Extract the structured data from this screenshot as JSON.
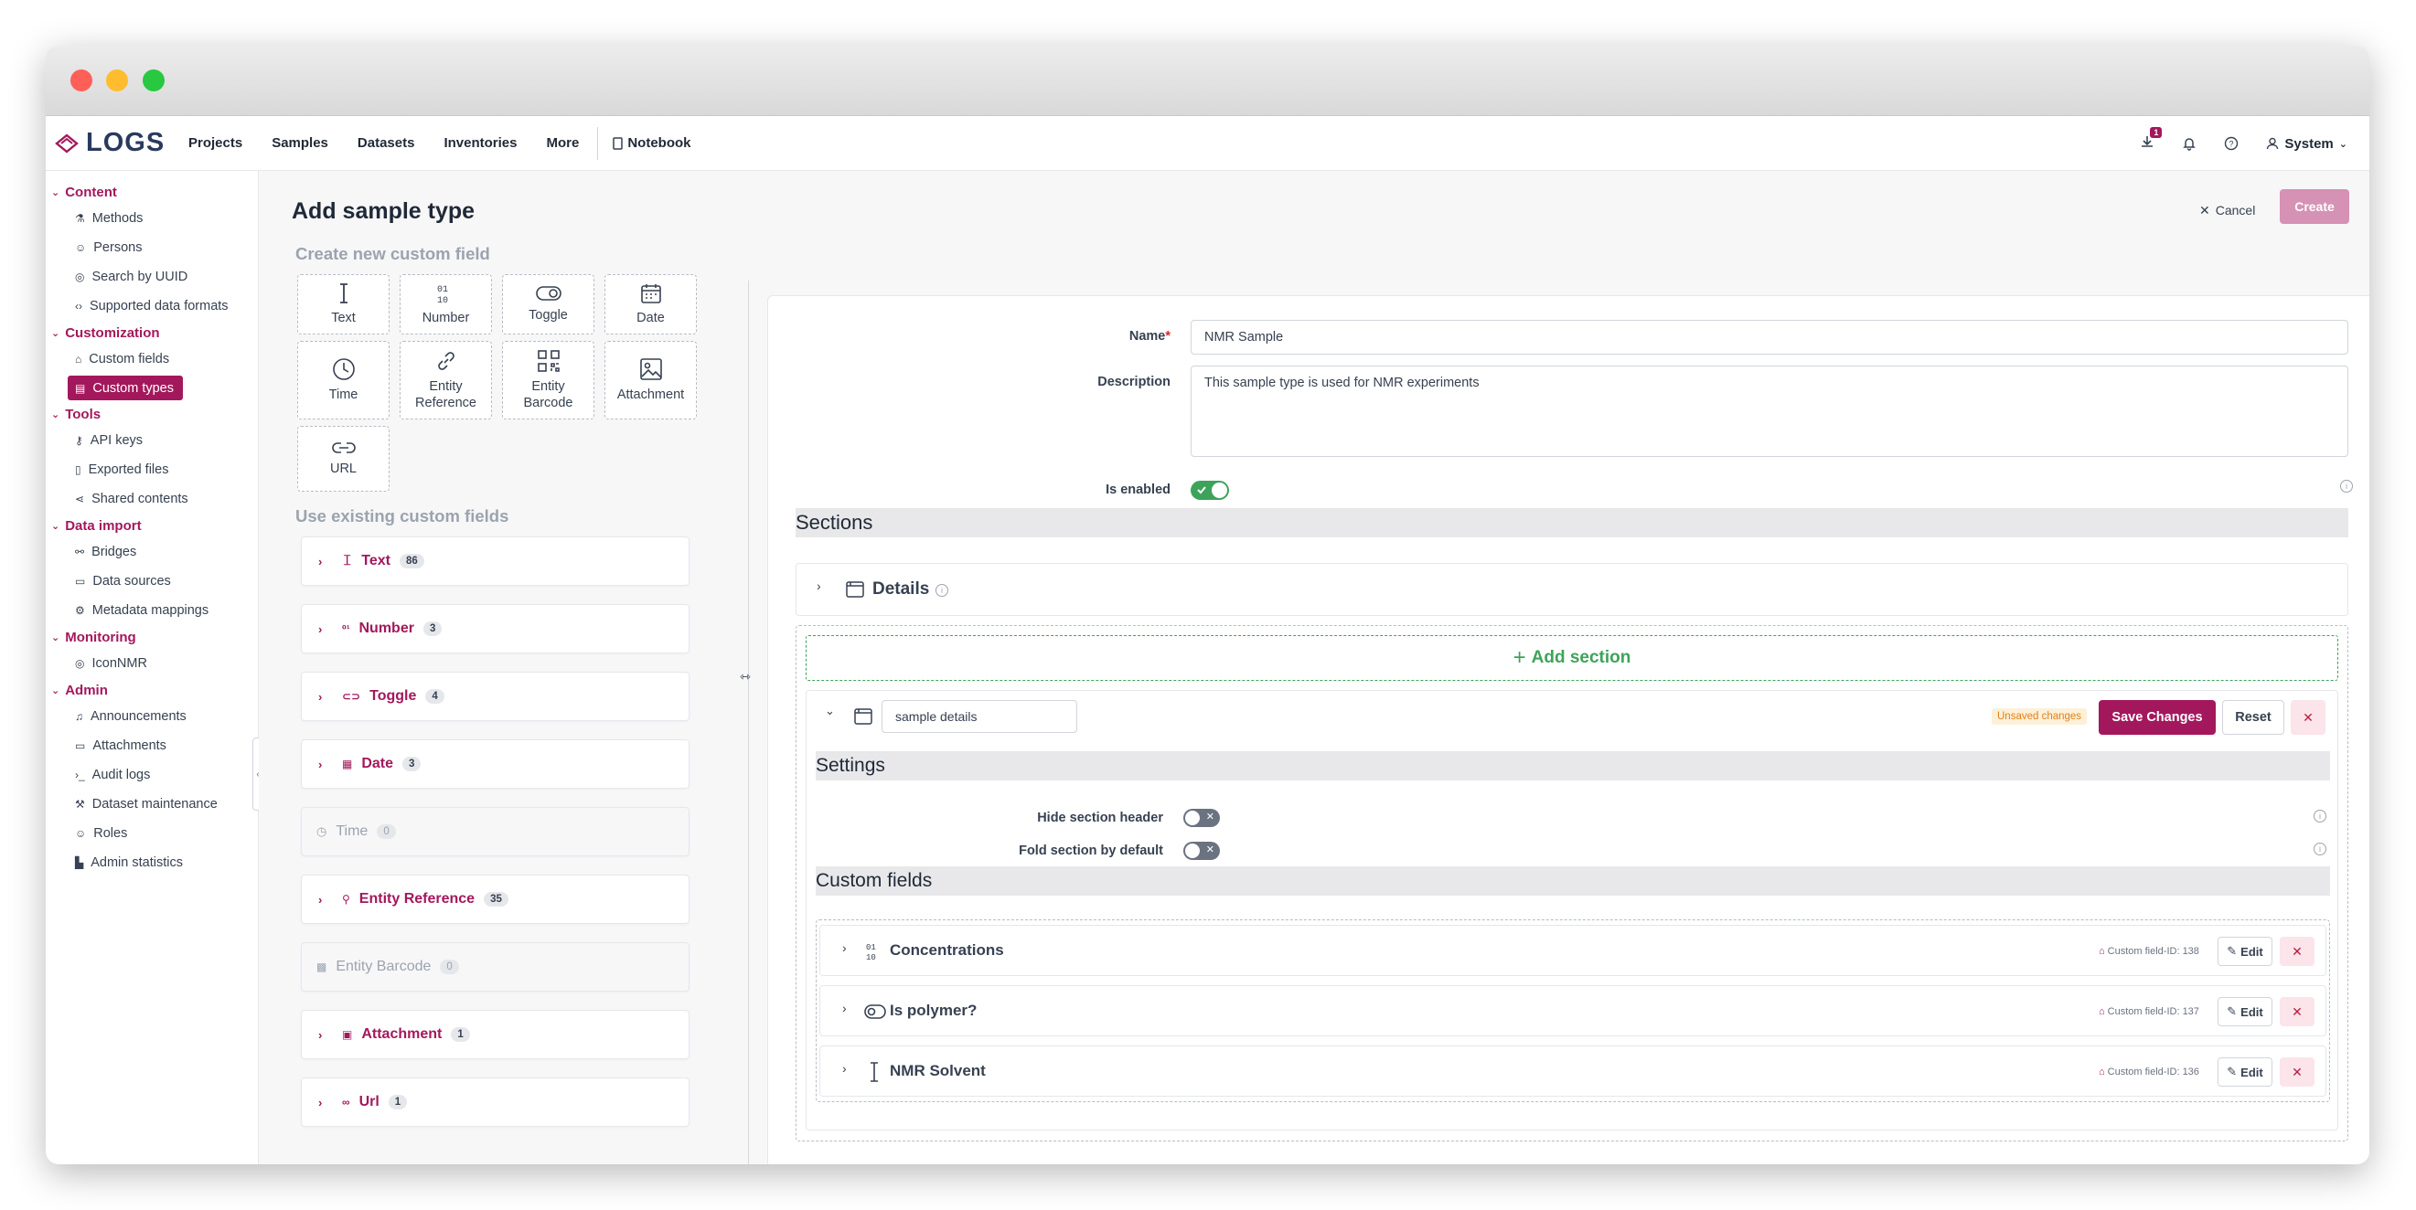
{
  "app": {
    "logo_text": "LOGS",
    "accent": "#a3185c"
  },
  "topnav": {
    "items": [
      "Projects",
      "Samples",
      "Datasets",
      "Inventories",
      "More"
    ],
    "notebook": "Notebook",
    "download_badge": "1",
    "user": "System"
  },
  "sidebar": {
    "groups": [
      {
        "label": "Content",
        "items": [
          "Methods",
          "Persons",
          "Search by UUID",
          "Supported data formats"
        ]
      },
      {
        "label": "Customization",
        "items": [
          "Custom fields",
          "Custom types"
        ]
      },
      {
        "label": "Tools",
        "items": [
          "API keys",
          "Exported files",
          "Shared contents"
        ]
      },
      {
        "label": "Data import",
        "items": [
          "Bridges",
          "Data sources",
          "Metadata mappings"
        ]
      },
      {
        "label": "Monitoring",
        "items": [
          "IconNMR"
        ]
      },
      {
        "label": "Admin",
        "items": [
          "Announcements",
          "Attachments",
          "Audit logs",
          "Dataset maintenance",
          "Roles",
          "Admin statistics"
        ]
      }
    ]
  },
  "page": {
    "title": "Add sample type",
    "cancel": "Cancel",
    "create": "Create"
  },
  "left_panel": {
    "create_heading": "Create new custom field",
    "tiles": [
      {
        "line1": "Text",
        "line2": ""
      },
      {
        "line1": "Number",
        "line2": ""
      },
      {
        "line1": "Toggle",
        "line2": ""
      },
      {
        "line1": "Date",
        "line2": ""
      },
      {
        "line1": "Time",
        "line2": ""
      },
      {
        "line1": "Entity",
        "line2": "Reference"
      },
      {
        "line1": "Entity",
        "line2": "Barcode"
      },
      {
        "line1": "Attachment",
        "line2": ""
      },
      {
        "line1": "URL",
        "line2": ""
      }
    ],
    "existing_heading": "Use existing custom fields",
    "existing": [
      {
        "label": "Text",
        "count": "86"
      },
      {
        "label": "Number",
        "count": "3"
      },
      {
        "label": "Toggle",
        "count": "4"
      },
      {
        "label": "Date",
        "count": "3"
      },
      {
        "label": "Time",
        "count": "0"
      },
      {
        "label": "Entity Reference",
        "count": "35"
      },
      {
        "label": "Entity Barcode",
        "count": "0"
      },
      {
        "label": "Attachment",
        "count": "1"
      },
      {
        "label": "Url",
        "count": "1"
      }
    ]
  },
  "form": {
    "name_label": "Name",
    "required_mark": "*",
    "name_value": "NMR Sample",
    "description_label": "Description",
    "description_value": "This sample type is used for NMR experiments",
    "enabled_label": "Is enabled",
    "sections_heading": "Sections",
    "details_section": "Details",
    "add_section": "Add section",
    "section_name_value": "sample details",
    "unsaved": "Unsaved changes",
    "save_changes": "Save Changes",
    "reset": "Reset",
    "settings_heading": "Settings",
    "hide_header_label": "Hide section header",
    "fold_label": "Fold section by default",
    "custom_fields_heading": "Custom fields",
    "custom_fields": [
      {
        "name": "Concentrations",
        "id": "Custom field-ID: 138",
        "icon": "number-icon"
      },
      {
        "name": "Is polymer?",
        "id": "Custom field-ID: 137",
        "icon": "toggle-icon"
      },
      {
        "name": "NMR Solvent",
        "id": "Custom field-ID: 136",
        "icon": "text-cursor-icon"
      }
    ],
    "edit": "Edit"
  }
}
